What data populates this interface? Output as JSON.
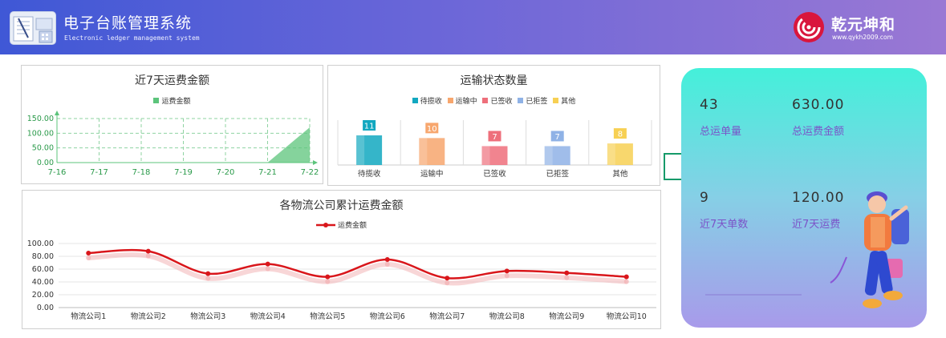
{
  "header": {
    "title": "电子台账管理系统",
    "subtitle": "Electronic ledger management system",
    "brand_name": "乾元坤和",
    "brand_url": "www.qykh2009.com"
  },
  "panel_freight7": {
    "title": "近7天运费金额",
    "legend": "运费金额"
  },
  "panel_status": {
    "title": "运输状态数量",
    "legend": [
      "待揽收",
      "运输中",
      "已签收",
      "已拒签",
      "其他"
    ]
  },
  "panel_company": {
    "title": "各物流公司累计运费金额",
    "legend": "运费金额"
  },
  "stats": {
    "total_orders_value": "43",
    "total_orders_label": "总运单量",
    "total_amount_value": "630.00",
    "total_amount_label": "总运费金额",
    "week_orders_value": "9",
    "week_orders_label": "近7天单数",
    "week_freight_value": "120.00",
    "week_freight_label": "近7天运费"
  },
  "colors": {
    "header_start": "#3f58d6",
    "header_end": "#9a78d4",
    "area_green": "#5cc47b",
    "line_red": "#d9161b",
    "status": [
      "#12a8c0",
      "#f7a66d",
      "#ee6f7b",
      "#8fb2e6",
      "#f7d053"
    ]
  },
  "chart_data": [
    {
      "type": "area",
      "title": "近7天运费金额",
      "categories": [
        "7-16",
        "7-17",
        "7-18",
        "7-19",
        "7-20",
        "7-21",
        "7-22"
      ],
      "series": [
        {
          "name": "运费金额",
          "values": [
            0,
            0,
            0,
            0,
            0,
            0,
            120
          ]
        }
      ],
      "y_ticks": [
        "0.00",
        "50.00",
        "100.00",
        "150.00"
      ],
      "ylim": [
        0,
        150
      ],
      "grid": true,
      "legend_position": "top-center"
    },
    {
      "type": "bar",
      "title": "运输状态数量",
      "categories": [
        "待揽收",
        "运输中",
        "已签收",
        "已拒签",
        "其他"
      ],
      "values": [
        11,
        10,
        7,
        7,
        8
      ],
      "legend_position": "top-center"
    },
    {
      "type": "line",
      "title": "各物流公司累计运费金额",
      "categories": [
        "物流公司1",
        "物流公司2",
        "物流公司3",
        "物流公司4",
        "物流公司5",
        "物流公司6",
        "物流公司7",
        "物流公司8",
        "物流公司9",
        "物流公司10"
      ],
      "series": [
        {
          "name": "运费金额",
          "values": [
            85,
            88,
            53,
            68,
            48,
            75,
            46,
            57,
            54,
            48
          ]
        }
      ],
      "y_ticks": [
        "0.00",
        "20.00",
        "40.00",
        "60.00",
        "80.00",
        "100.00"
      ],
      "ylim": [
        0,
        100
      ],
      "grid": true,
      "legend_position": "top-center"
    }
  ]
}
